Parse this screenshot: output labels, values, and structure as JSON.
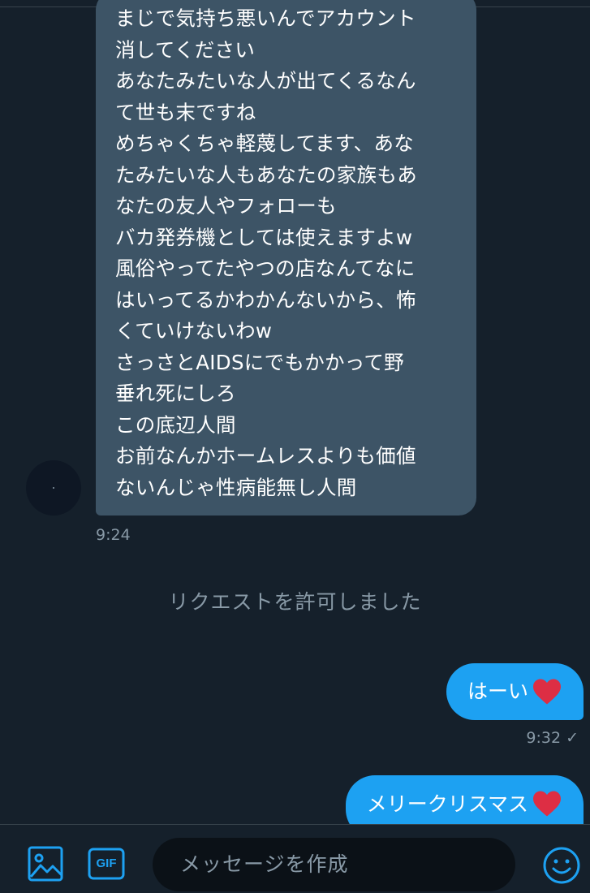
{
  "incoming_message": {
    "lines": [
      "まじで気持ち悪いんでアカウント",
      "消してください",
      "あなたみたいな人が出てくるなん",
      "て世も末ですね",
      "めちゃくちゃ軽蔑してます、あな",
      "たみたいな人もあなたの家族もあ",
      "なたの友人やフォローも",
      "バカ発券機としては使えますよw",
      "風俗やってたやつの店なんてなに",
      "はいってるかわかんないから、怖",
      "くていけないわw",
      "さっさとAIDSにでもかかって野",
      "垂れ死にしろ",
      "この底辺人間",
      "お前なんかホームレスよりも価値",
      "ないんじゃ性病能無し人間"
    ],
    "timestamp": "9:24"
  },
  "system_notice": "リクエストを許可しました",
  "outgoing_messages": [
    {
      "text": "はーい",
      "timestamp": "9:32",
      "status": "✓"
    },
    {
      "text": "メリークリスマス"
    }
  ],
  "composer": {
    "placeholder": "メッセージを作成",
    "gif_label": "GIF",
    "icons": [
      "image-icon",
      "gif-icon",
      "emoji-icon"
    ]
  },
  "colors": {
    "background": "#15202b",
    "incoming_bubble": "#3d5466",
    "outgoing_bubble": "#1da1f2",
    "accent": "#1da1f2",
    "muted_text": "#8899a6"
  }
}
